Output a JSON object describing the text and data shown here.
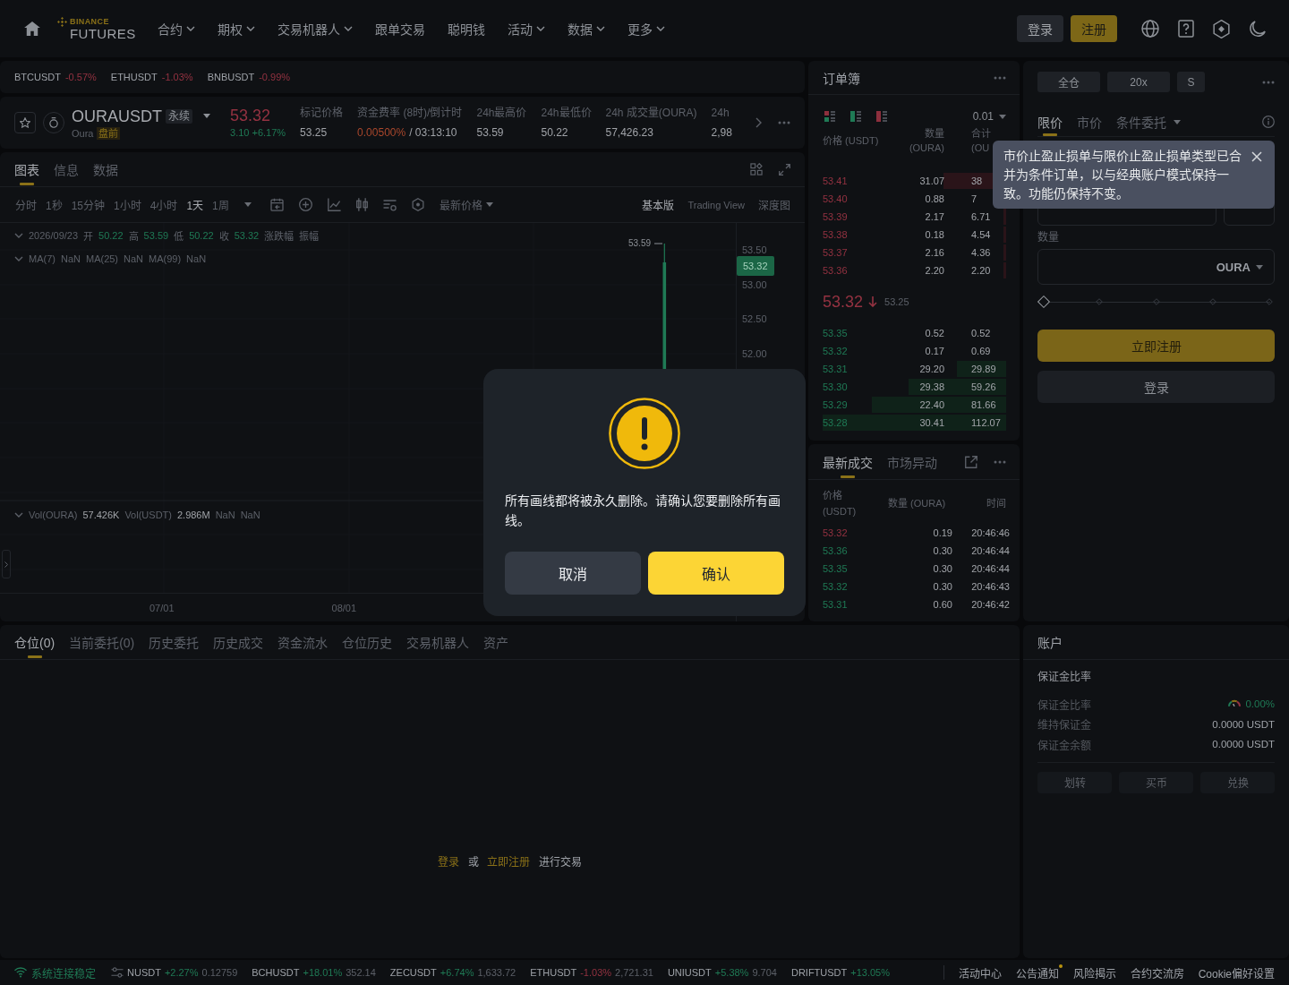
{
  "header": {
    "brand": "BINANCE",
    "product": "FUTURES",
    "nav": [
      {
        "label": "合约",
        "has_menu": true
      },
      {
        "label": "期权",
        "has_menu": true
      },
      {
        "label": "交易机器人",
        "has_menu": true
      },
      {
        "label": "跟单交易",
        "has_menu": false
      },
      {
        "label": "聪明钱",
        "has_menu": false
      },
      {
        "label": "活动",
        "has_menu": true
      },
      {
        "label": "数据",
        "has_menu": true
      },
      {
        "label": "更多",
        "has_menu": true
      }
    ],
    "login_button": "登录",
    "register_button": "注册"
  },
  "ticker_bar": [
    {
      "symbol": "BTCUSDT",
      "change": "-0.57%",
      "rising": false
    },
    {
      "symbol": "ETHUSDT",
      "change": "-1.03%",
      "rising": false
    },
    {
      "symbol": "BNBUSDT",
      "change": "-0.99%",
      "rising": false
    }
  ],
  "symbol_info": {
    "favorite": false,
    "symbol": "OURAUSDT",
    "contract_type": "永续",
    "asset_name": "Oura",
    "tag": "盘前",
    "last_price": "53.32",
    "last_rising": false,
    "change": "3.10 +6.17%",
    "change_rising": true,
    "stats": [
      {
        "label": "标记价格",
        "value": "53.25",
        "highlight": false
      },
      {
        "label": "资金费率 (8时)/倒计时",
        "value": "0.00500%",
        "highlight": true,
        "countdown": "/ 03:13:10"
      },
      {
        "label": "24h最高价",
        "value": "53.59",
        "highlight": false
      },
      {
        "label": "24h最低价",
        "value": "50.22",
        "highlight": false
      },
      {
        "label": "24h 成交量(OURA)",
        "value": "57,426.23",
        "highlight": false
      },
      {
        "label": "24h",
        "value": "2,98",
        "highlight": false
      }
    ]
  },
  "chart_panel": {
    "tabs": [
      {
        "label": "图表",
        "selected": true
      },
      {
        "label": "信息",
        "selected": false
      },
      {
        "label": "数据",
        "selected": false
      }
    ],
    "intervals": [
      {
        "label": "分时",
        "selected": false
      },
      {
        "label": "1秒",
        "selected": false
      },
      {
        "label": "15分钟",
        "selected": false
      },
      {
        "label": "1小时",
        "selected": false
      },
      {
        "label": "4小时",
        "selected": false
      },
      {
        "label": "1天",
        "selected": true
      },
      {
        "label": "1周",
        "selected": false
      }
    ],
    "price_source": "最新价格",
    "views": [
      {
        "label": "基本版",
        "selected": true
      },
      {
        "label": "Trading View",
        "selected": false
      },
      {
        "label": "深度图",
        "selected": false
      }
    ],
    "ohlc_legend": {
      "date": "2026/09/23",
      "rising": true,
      "items": [
        {
          "label": "开",
          "value": "50.22"
        },
        {
          "label": "高",
          "value": "53.59"
        },
        {
          "label": "低",
          "value": "50.22"
        },
        {
          "label": "收",
          "value": "53.32"
        },
        {
          "label": "涨跌幅"
        },
        {
          "label": "振幅"
        }
      ]
    },
    "ma_legend": [
      {
        "label": "MA(7)",
        "value": "NaN"
      },
      {
        "label": "MA(25)",
        "value": "NaN"
      },
      {
        "label": "MA(99)",
        "value": "NaN"
      }
    ],
    "high_label": "53.59",
    "price_axis": [
      "53.50",
      "53.00",
      "52.50",
      "52.00"
    ],
    "current_price": "53.32",
    "volume_legend": [
      {
        "label": "Vol(OURA)",
        "value": "57.426K"
      },
      {
        "label": "Vol(USDT)",
        "value": "2.986M"
      },
      {
        "label": "NaN"
      },
      {
        "label": "NaN"
      }
    ],
    "time_axis": [
      "07/01",
      "08/01"
    ]
  },
  "order_book": {
    "title": "订单簿",
    "tick_size": "0.01",
    "columns": [
      "价格 (USDT)",
      "数量 (OURA)",
      "合计 (OU"
    ],
    "asks": [
      {
        "price": "53.41",
        "amount": "31.07",
        "total": "38"
      },
      {
        "price": "53.40",
        "amount": "0.88",
        "total": "7"
      },
      {
        "price": "53.39",
        "amount": "2.17",
        "total": "6.71"
      },
      {
        "price": "53.38",
        "amount": "0.18",
        "total": "4.54"
      },
      {
        "price": "53.37",
        "amount": "2.16",
        "total": "4.36"
      },
      {
        "price": "53.36",
        "amount": "2.20",
        "total": "2.20"
      }
    ],
    "last_price": "53.32",
    "last_rising": false,
    "mark_price": "53.25",
    "bids": [
      {
        "price": "53.35",
        "amount": "0.52",
        "total": "0.52"
      },
      {
        "price": "53.32",
        "amount": "0.17",
        "total": "0.69"
      },
      {
        "price": "53.31",
        "amount": "29.20",
        "total": "29.89"
      },
      {
        "price": "53.30",
        "amount": "29.38",
        "total": "59.26"
      },
      {
        "price": "53.29",
        "amount": "22.40",
        "total": "81.66"
      },
      {
        "price": "53.28",
        "amount": "30.41",
        "total": "112.07"
      }
    ]
  },
  "recent_trades": {
    "tabs": [
      {
        "label": "最新成交",
        "selected": true
      },
      {
        "label": "市场异动",
        "selected": false
      }
    ],
    "columns": [
      "价格 (USDT)",
      "数量 (OURA)",
      "时间"
    ],
    "rows": [
      {
        "price": "53.32",
        "amount": "0.19",
        "time": "20:46:46",
        "rising": false
      },
      {
        "price": "53.36",
        "amount": "0.30",
        "time": "20:46:44",
        "rising": true
      },
      {
        "price": "53.35",
        "amount": "0.30",
        "time": "20:46:44",
        "rising": true
      },
      {
        "price": "53.32",
        "amount": "0.30",
        "time": "20:46:43",
        "rising": true
      },
      {
        "price": "53.31",
        "amount": "0.60",
        "time": "20:46:42",
        "rising": true
      }
    ]
  },
  "order_form": {
    "mode_buttons": [
      "全仓",
      "20x",
      "S"
    ],
    "order_types": [
      {
        "label": "限价",
        "selected": true,
        "has_menu": false
      },
      {
        "label": "市价",
        "selected": false,
        "has_menu": false
      },
      {
        "label": "条件委托",
        "selected": false,
        "has_menu": true
      }
    ],
    "tooltip": "市价止盈止损单与限价止盈止损单类型已合并为条件订单，以与经典账户模式保持一致。功能仍保持不变。",
    "quantity_label": "数量",
    "quantity_unit": "OURA",
    "slider": {
      "level": 0
    },
    "register_button": "立即注册",
    "login_button": "登录"
  },
  "positions_panel": {
    "tabs": [
      {
        "label": "仓位(0)",
        "selected": true
      },
      {
        "label": "当前委托(0)",
        "selected": false
      },
      {
        "label": "历史委托",
        "selected": false
      },
      {
        "label": "历史成交",
        "selected": false
      },
      {
        "label": "资金流水",
        "selected": false
      },
      {
        "label": "仓位历史",
        "selected": false
      },
      {
        "label": "交易机器人",
        "selected": false
      },
      {
        "label": "资产",
        "selected": false
      }
    ],
    "prompt": [
      {
        "text": "登录",
        "kind": "link"
      },
      {
        "text": "或",
        "kind": "text"
      },
      {
        "text": "立即注册",
        "kind": "link"
      },
      {
        "text": "进行交易",
        "kind": "text"
      }
    ]
  },
  "account_panel": {
    "title": "账户",
    "section": "保证金比率",
    "rows": [
      {
        "label": "保证金比率",
        "value": "0.00%",
        "kind": "ratio"
      },
      {
        "label": "维持保证金",
        "value": "0.0000 USDT",
        "kind": "amount"
      },
      {
        "label": "保证金余额",
        "value": "0.0000 USDT",
        "kind": "amount"
      }
    ],
    "buttons": [
      {
        "label": "划转",
        "disabled": true
      },
      {
        "label": "买币",
        "disabled": true
      },
      {
        "label": "兑换",
        "disabled": true
      }
    ]
  },
  "status_bar": {
    "connection": "系统连接稳定",
    "tickers": [
      {
        "symbol": "NUSDT",
        "change": "+2.27%",
        "price": "0.12759",
        "rising": true
      },
      {
        "symbol": "BCHUSDT",
        "change": "+18.01%",
        "price": "352.14",
        "rising": true
      },
      {
        "symbol": "ZECUSDT",
        "change": "+6.74%",
        "price": "1,633.72",
        "rising": true
      },
      {
        "symbol": "ETHUSDT",
        "change": "-1.03%",
        "price": "2,721.31",
        "rising": false
      },
      {
        "symbol": "UNIUSDT",
        "change": "+5.38%",
        "price": "9.704",
        "rising": true
      },
      {
        "symbol": "DRIFTUSDT",
        "change": "+13.05%",
        "rising": true
      }
    ],
    "links": [
      {
        "label": "活动中心",
        "badge": false
      },
      {
        "label": "公告通知",
        "badge": true
      },
      {
        "label": "风险揭示",
        "badge": false
      },
      {
        "label": "合约交流房",
        "badge": false
      },
      {
        "label": "Cookie偏好设置",
        "badge": false
      }
    ]
  },
  "dialog": {
    "message": "所有画线都将被永久删除。请确认您要删除所有画线。",
    "cancel_button": "取消",
    "confirm_button": "确认"
  }
}
